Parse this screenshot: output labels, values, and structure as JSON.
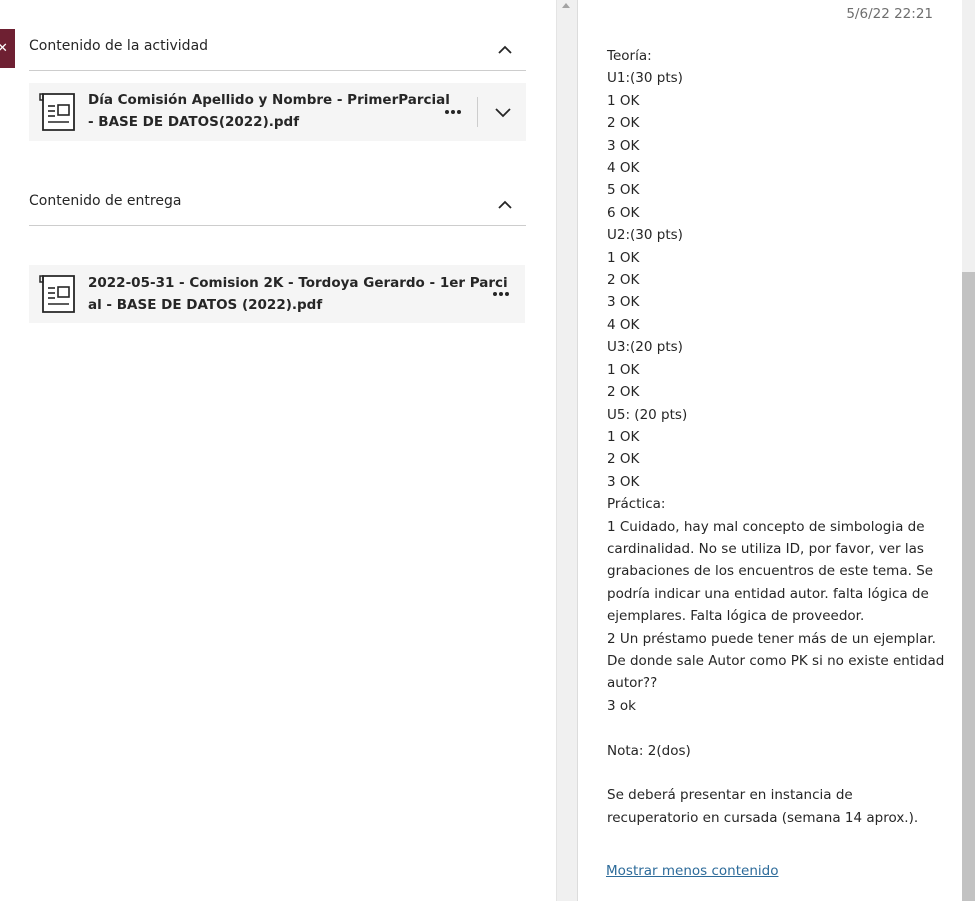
{
  "close_tab": {
    "icon": "close-icon",
    "glyph": "✕",
    "color": "#6e2032"
  },
  "activity_section": {
    "title": "Contenido de la actividad",
    "file": {
      "name_line1": "Día Comisión Apellido y Nombre - PrimerParcial",
      "name_line2": "- BASE DE DATOS(2022).pdf",
      "icon": "document-icon"
    }
  },
  "submission_section": {
    "title": "Contenido de entrega",
    "file": {
      "name_line1": "2022-05-31 - Comision 2K - Tordoya Gerardo - 1er Parci",
      "name_line2": "al - BASE DE DATOS (2022).pdf",
      "icon": "document-icon"
    }
  },
  "feedback": {
    "timestamp": "5/6/22 22:21",
    "lines": [
      "Teoría:",
      "U1:(30 pts)",
      "1 OK",
      "2 OK",
      "3 OK",
      "4 OK",
      "5 OK",
      "6 OK",
      "U2:(30 pts)",
      "1 OK",
      "2 OK",
      "3 OK",
      "4 OK",
      "U3:(20 pts)",
      "1 OK",
      "2 OK",
      "U5: (20 pts)",
      "1 OK",
      "2 OK",
      "3 OK",
      "Práctica:"
    ],
    "practica_1": "1 Cuidado, hay mal concepto de simbologia de cardinalidad. No se utiliza ID, por favor, ver las grabaciones de los encuentros de este tema. Se podría indicar una entidad autor. falta lógica de ejemplares. Falta lógica de proveedor.",
    "practica_2": "2 Un préstamo puede tener más de un ejemplar. De donde sale Autor como PK si no existe entidad autor??",
    "practica_3": "3 ok",
    "nota": "Nota: 2(dos)",
    "recuperatorio": "Se deberá presentar en instancia de recuperatorio en cursada (semana 14 aprox.).",
    "show_less_link": "Mostrar menos contenido"
  },
  "colors": {
    "accent": "#6e2032",
    "link": "#2d6b9a",
    "card_bg": "#f5f5f5"
  }
}
